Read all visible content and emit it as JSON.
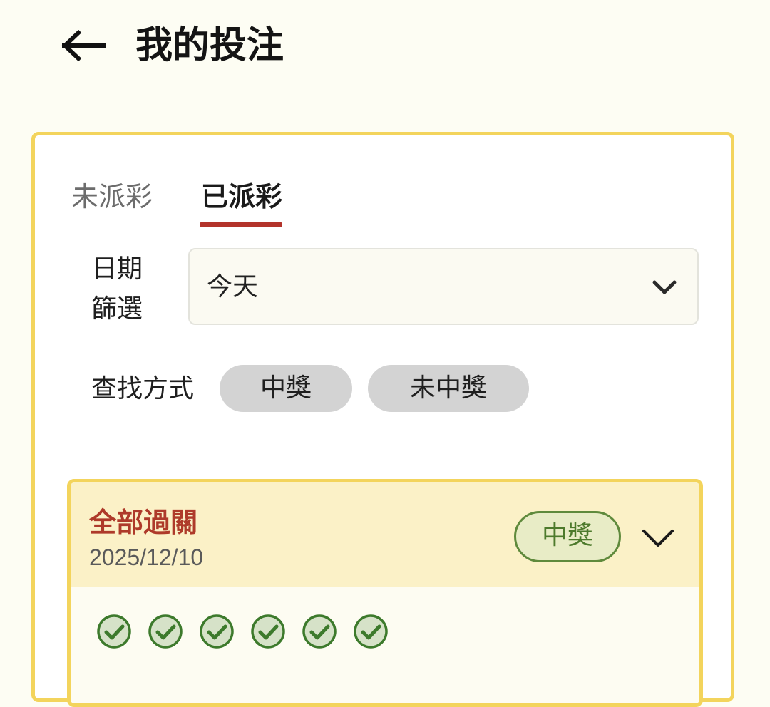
{
  "header": {
    "title": "我的投注",
    "back_icon": "arrow-left-icon"
  },
  "tabs": [
    {
      "label": "未派彩",
      "active": false
    },
    {
      "label": "已派彩",
      "active": true
    }
  ],
  "filters": {
    "date_label": "日期篩選",
    "date_value": "今天",
    "search_label": "查找方式",
    "search_options": [
      "中獎",
      "未中獎"
    ]
  },
  "bet_card": {
    "type": "全部過關",
    "date": "2025/12/10",
    "result_badge": "中獎",
    "leg_results": [
      "check",
      "check",
      "check",
      "check",
      "check",
      "check"
    ]
  },
  "colors": {
    "background": "#fdfdf3",
    "card_border": "#f3d45c",
    "tab_underline": "#b3332b",
    "bet_type": "#ae3a2a",
    "win_green": "#4d7a2c",
    "win_badge_bg": "#e8ecc6",
    "check_fill": "#d6e2c8",
    "check_stroke": "#3d7a2c"
  }
}
